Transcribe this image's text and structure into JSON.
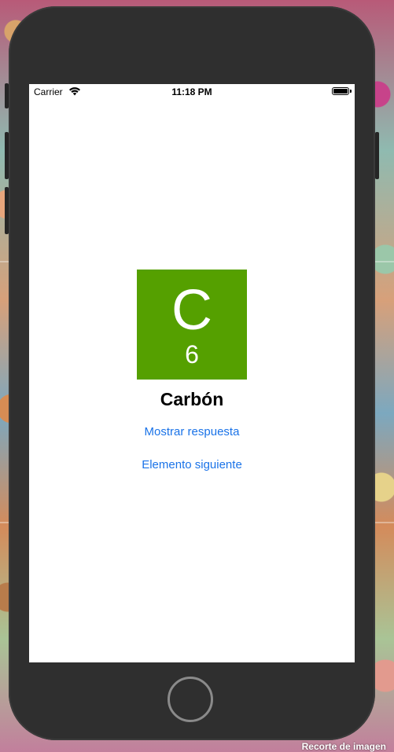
{
  "status_bar": {
    "carrier": "Carrier",
    "time": "11:18 PM"
  },
  "element": {
    "symbol": "C",
    "number": "6",
    "name": "Carbón",
    "tile_color": "#55a000"
  },
  "buttons": {
    "show_answer": "Mostrar respuesta",
    "next_element": "Elemento siguiente"
  },
  "overlay": {
    "crop_label": "Recorte de imagen"
  },
  "icons": {
    "wifi": "wifi-icon",
    "battery": "battery-icon",
    "home": "home-button-icon"
  }
}
